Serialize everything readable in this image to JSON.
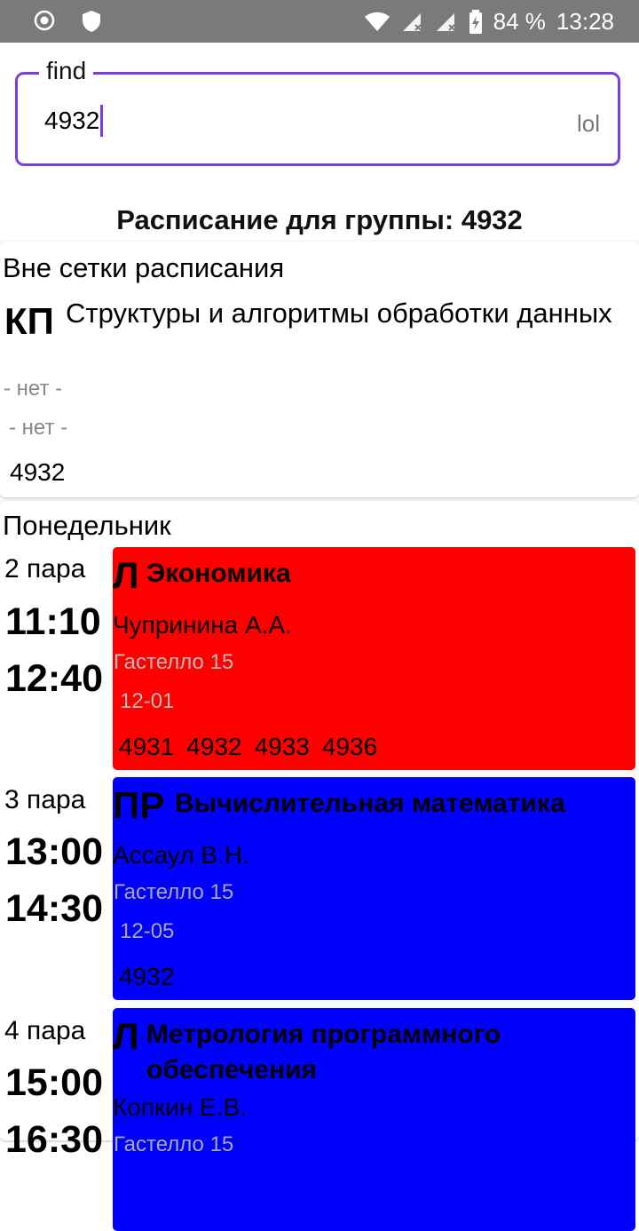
{
  "status_bar": {
    "battery": "84 %",
    "time": "13:28",
    "icons": [
      "record-icon",
      "shield-icon",
      "wifi-icon",
      "signal-icon",
      "signal-icon",
      "battery-charging-icon"
    ]
  },
  "search": {
    "label": "find",
    "value": "4932",
    "suffix": "lol"
  },
  "group_title": "Расписание для группы: 4932",
  "off_grid": {
    "title": "Вне сетки расписания",
    "type": "КП",
    "subject": "Структуры и алгоритмы обработки данных",
    "teacher": "- нет -",
    "place": "- нет -",
    "group": "4932"
  },
  "day": {
    "title": "Понедельник",
    "lessons": [
      {
        "pair": "2 пара",
        "start": "11:10",
        "end": "12:40",
        "type": "Л",
        "subject": "Экономика",
        "teacher": "Чупринина А.А.",
        "address": "Гастелло 15",
        "room": "12-01",
        "groups": [
          "4931",
          "4932",
          "4933",
          "4936"
        ],
        "color": "#ff0000"
      },
      {
        "pair": "3 пара",
        "start": "13:00",
        "end": "14:30",
        "type": "ПР",
        "subject": "Вычислительная математика",
        "teacher": "Ассаул В.Н.",
        "address": "Гастелло 15",
        "room": "12-05",
        "groups": [
          "4932"
        ],
        "color": "#0000ff"
      },
      {
        "pair": "4 пара",
        "start": "15:00",
        "end": "16:30",
        "type": "Л",
        "subject": "Метрология программного обеспечения",
        "teacher": "Копкин Е.В.",
        "address": "Гастелло 15",
        "color": "#0000ff"
      }
    ]
  }
}
